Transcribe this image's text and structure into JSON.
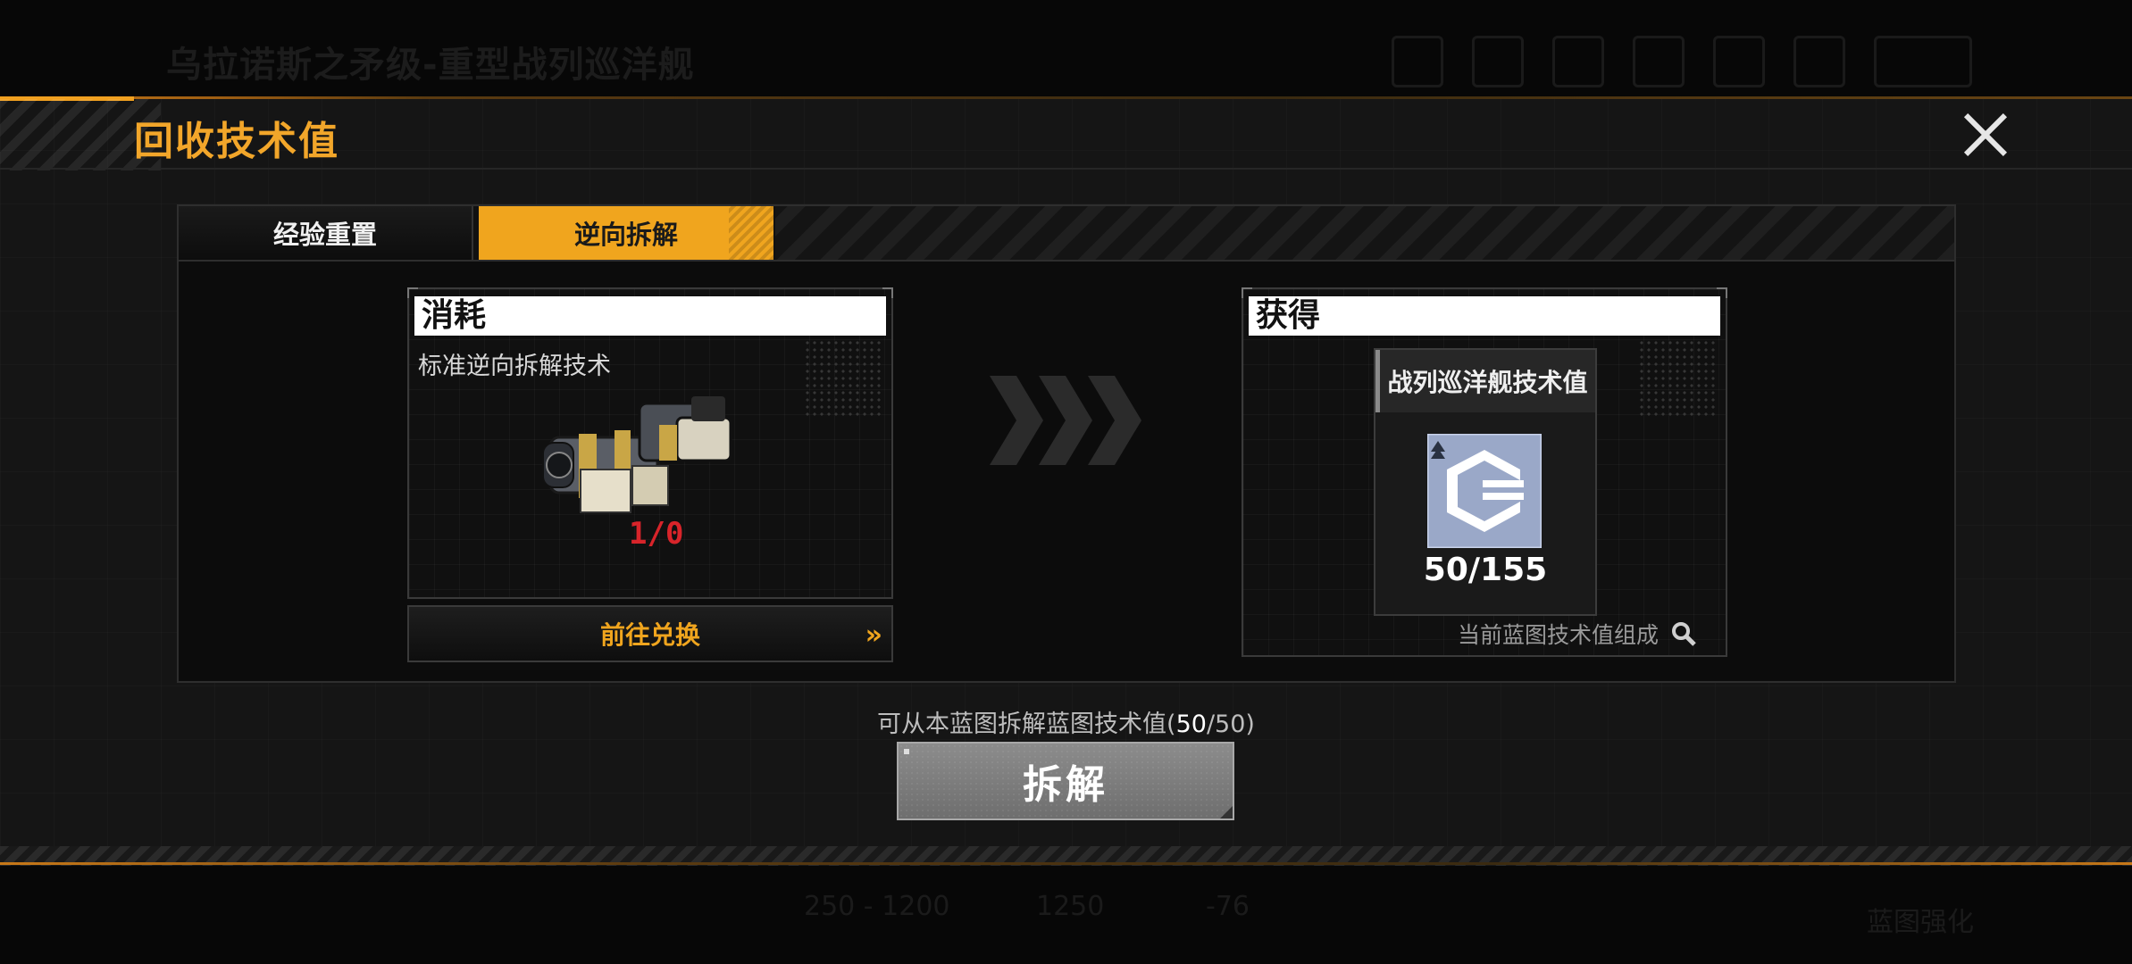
{
  "background": {
    "title": "乌拉诺斯之矛级-重型战列巡洋舰",
    "footer_values": [
      "250 - 1200",
      "1250",
      "-76",
      "蓝图强化"
    ]
  },
  "modal": {
    "title": "回收技术值",
    "tabs": [
      {
        "label": "经验重置",
        "active": false
      },
      {
        "label": "逆向拆解",
        "active": true
      }
    ],
    "consume": {
      "header": "消耗",
      "item_name": "标准逆向拆解技术",
      "item_count": "1/0",
      "goto_label": "前往兑换",
      "goto_arrow": "»"
    },
    "gain": {
      "header": "获得",
      "item_name": "战列巡洋舰技术值",
      "item_count": "50/155",
      "composition_label": "当前蓝图技术值组成"
    },
    "info_prefix": "可从本蓝图拆解蓝图技术值(",
    "info_value": "50",
    "info_sep": "/",
    "info_total": "50",
    "info_suffix": ")",
    "dismantle_label": "拆解"
  },
  "colors": {
    "accent": "#f0a51e",
    "warning_red": "#d8242a",
    "tech_icon_bg": "#9aa8c8"
  }
}
